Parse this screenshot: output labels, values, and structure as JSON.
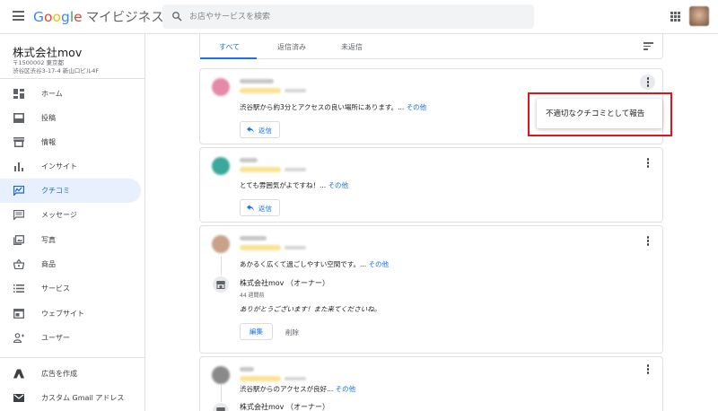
{
  "header": {
    "logo_letters": [
      "G",
      "o",
      "o",
      "g",
      "l",
      "e"
    ],
    "product_name": "マイビジネス",
    "search_placeholder": "お店やサービスを検索",
    "menu_icon": "hamburger-menu-icon",
    "apps_icon": "apps-grid-icon"
  },
  "sidebar": {
    "business_name": "株式会社mov",
    "address_line1": "〒1500002 東京都",
    "address_line2": "渋谷区渋谷3-17-4 新山口ビル4F",
    "items": [
      {
        "label": "ホーム",
        "icon": "dashboard-icon",
        "active": false
      },
      {
        "label": "投稿",
        "icon": "post-icon",
        "active": false
      },
      {
        "label": "情報",
        "icon": "store-info-icon",
        "active": false
      },
      {
        "label": "インサイト",
        "icon": "insights-bar-icon",
        "active": false
      },
      {
        "label": "クチコミ",
        "icon": "reviews-icon",
        "active": true
      },
      {
        "label": "メッセージ",
        "icon": "message-icon",
        "active": false
      },
      {
        "label": "写真",
        "icon": "photo-icon",
        "active": false
      },
      {
        "label": "商品",
        "icon": "basket-icon",
        "active": false
      },
      {
        "label": "サービス",
        "icon": "list-icon",
        "active": false
      },
      {
        "label": "ウェブサイト",
        "icon": "website-icon",
        "active": false
      },
      {
        "label": "ユーザー",
        "icon": "add-person-icon",
        "active": false
      }
    ],
    "bottom_items": [
      {
        "label": "広告を作成",
        "icon": "google-ads-icon"
      },
      {
        "label": "カスタム Gmail アドレス",
        "icon": "gmail-icon"
      }
    ]
  },
  "tabs": {
    "all": "すべて",
    "replied": "返信済み",
    "unreplied": "未返信",
    "active": "すべて"
  },
  "reviews": [
    {
      "text": "渋谷駅から約3分とアクセスの良い場所にあります。... ",
      "more": "その他",
      "reply_label": "返信",
      "avatar_color": "#e48aa8"
    },
    {
      "text": "とても雰囲気がよですね！... ",
      "more": "その他",
      "reply_label": "返信",
      "avatar_color": "#3aa89a"
    },
    {
      "text": "あかるく広くて過ごしやすい空間です。... ",
      "more": "その他",
      "avatar_color": "#c9a088",
      "owner": {
        "name": "株式会社mov （オーナー）",
        "date": "44 週間前",
        "reply": "ありがとうございます！また来てくださいね。",
        "edit_label": "編集",
        "delete_label": "削除"
      }
    },
    {
      "text": "渋谷駅からのアクセスが良好... ",
      "more": "その他",
      "avatar_color": "#8a8a8a",
      "owner": {
        "name": "株式会社mov （オーナー）"
      }
    }
  ],
  "popup_menu": {
    "report_label": "不適切なクチコミとして報告"
  }
}
